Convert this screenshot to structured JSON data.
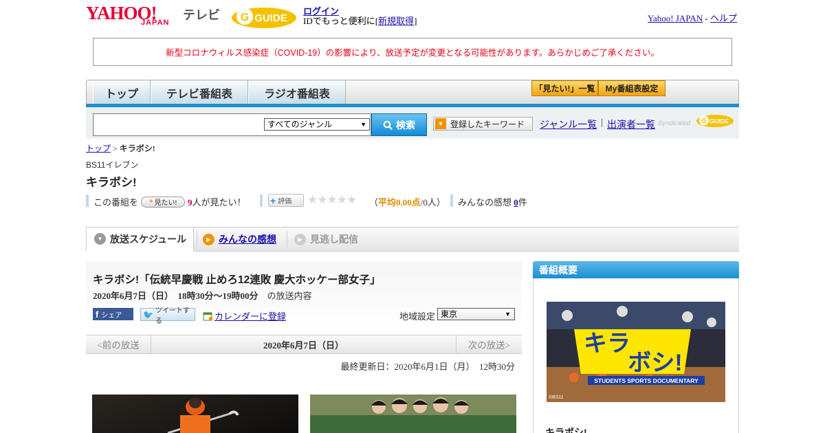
{
  "header": {
    "yahoo_logo": "YAHOO!",
    "yahoo_sub": "JAPAN",
    "tv_label": "テレビ",
    "gguide_logo": "GUIDE",
    "login_link": "ログイン",
    "id_text_prefix": "IDでもっと便利に[",
    "signup_link": "新規取得",
    "id_text_suffix": "]",
    "yahoo_japan_link": "Yahoo! JAPAN",
    "separator": " - ",
    "help_link": "ヘルプ"
  },
  "notice": "新型コロナウィルス感染症（COVID-19）の影響により、放送予定が変更となる可能性があります。あらかじめご了承ください。",
  "nav": {
    "tabs": [
      "トップ",
      "テレビ番組表",
      "ラジオ番組表"
    ],
    "want_list_button": "「見たい!」一覧",
    "my_listing_button": "My番組表設定"
  },
  "search": {
    "input_value": "",
    "genre_selected": "すべてのジャンル",
    "search_button": "検索",
    "keyword_button": "登録したキーワード",
    "genre_list_link": "ジャンル一覧",
    "separator": "|",
    "cast_list_link": "出演者一覧",
    "syndicated": "Syndicated"
  },
  "breadcrumb": {
    "home": "トップ",
    "separator": " > ",
    "current": "キラボシ!"
  },
  "program": {
    "channel": "BS11イレブン",
    "title": "キラボシ!",
    "want_prefix": "この番組を",
    "want_button": "見たい!",
    "want_count": "9",
    "want_suffix": "人が見たい！",
    "rate_button": "評価",
    "rating_stars": 0,
    "rating_open": "（",
    "rating_avg": "平均0.00点",
    "rating_suffix": "/0人）",
    "impressions_label": "みんなの感想",
    "impressions_count": "0",
    "impressions_unit": "件"
  },
  "subtabs": [
    "放送スケジュール",
    "みんなの感想",
    "見逃し配信"
  ],
  "episode": {
    "title": "キラボシ!「伝統早慶戦 止めろ12連敗 慶大ホッケー部女子」",
    "date_time": "2020年6月7日（日）　18時30分～19時00分",
    "date_suffix": "の放送内容",
    "share_fb": "シェア",
    "share_tw": "ツイートする",
    "calendar_link": "カレンダーに登録",
    "region_label": "地域設定",
    "region_selected": "東京"
  },
  "date_nav": {
    "prev": "<前の放送",
    "current": "2020年6月7日（日）",
    "next": "次の放送>"
  },
  "updated": "最終更新日：2020年6月1日（月）　12時30分",
  "sidebar": {
    "header": "番組概要",
    "image_title_line1": "キラ",
    "image_title_line2": "ボシ!",
    "image_subtitle": "STUDENTS SPORTS DOCUMENTARY",
    "image_credit": "©BS11",
    "program_title": "キラボシ!"
  },
  "colors": {
    "brand_red": "#e60033",
    "nav_blue": "#1b8fd0",
    "notice_red": "#e60012",
    "want_pink": "#c0006a",
    "rating_orange": "#e08a00"
  }
}
